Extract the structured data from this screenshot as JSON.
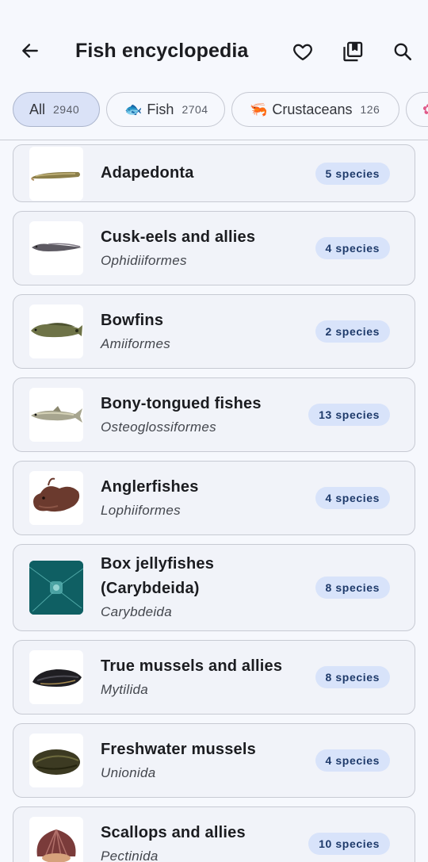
{
  "app": {
    "title": "Fish encyclopedia",
    "back_icon": "arrow-left-icon",
    "actions": [
      "heart-icon",
      "bookmarks-icon",
      "search-icon"
    ]
  },
  "filters": [
    {
      "label": "All",
      "count": "2940",
      "emoji": "",
      "selected": true
    },
    {
      "label": "Fish",
      "count": "2704",
      "emoji": "🐟",
      "selected": false
    },
    {
      "label": "Crustaceans",
      "count": "126",
      "emoji": "🦐",
      "selected": false
    }
  ],
  "groups": [
    {
      "name": "Adapedonta",
      "sci": "",
      "badge": "5 species",
      "thumb": "razor-clam-image"
    },
    {
      "name": "Cusk-eels and allies",
      "sci": "Ophidiiformes",
      "badge": "4 species",
      "thumb": "cusk-eel-image"
    },
    {
      "name": "Bowfins",
      "sci": "Amiiformes",
      "badge": "2 species",
      "thumb": "bowfin-image"
    },
    {
      "name": "Bony-tongued fishes",
      "sci": "Osteoglossiformes",
      "badge": "13 species",
      "thumb": "bony-tongue-image"
    },
    {
      "name": "Anglerfishes",
      "sci": "Lophiiformes",
      "badge": "4 species",
      "thumb": "anglerfish-image"
    },
    {
      "name": "Box jellyfishes (Carybdeida)",
      "name_line1": "Box jellyfishes",
      "name_line2": "(Carybdeida)",
      "sci": "Carybdeida",
      "badge": "8 species",
      "thumb": "box-jellyfish-image"
    },
    {
      "name": "True mussels and allies",
      "sci": "Mytilida",
      "badge": "8 species",
      "thumb": "mussel-image"
    },
    {
      "name": "Freshwater mussels",
      "sci": "Unionida",
      "badge": "4 species",
      "thumb": "freshwater-mussel-image"
    },
    {
      "name": "Scallops and allies",
      "sci": "Pectinida",
      "badge": "10 species",
      "thumb": "scallop-image"
    }
  ],
  "colors": {
    "background": "#f6f8fd",
    "card": "#f1f3f9",
    "badge": "#d8e3fa",
    "chip_selected": "#dae2f7"
  }
}
